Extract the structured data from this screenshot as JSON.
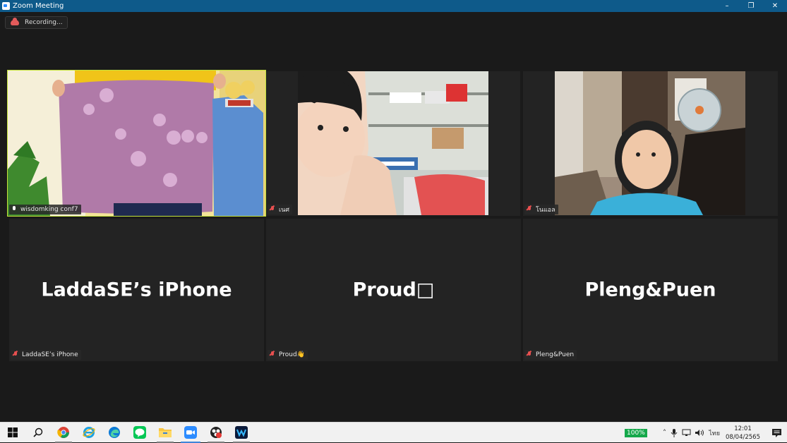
{
  "window": {
    "title": "Zoom Meeting",
    "controls": [
      "–",
      "❐",
      "✕"
    ]
  },
  "recording": {
    "label": "Recording..."
  },
  "participants": [
    {
      "name": "wisdomking conf7",
      "muted": false,
      "active": true,
      "video": true
    },
    {
      "name": "เนศ",
      "muted": true,
      "video": true
    },
    {
      "name": "โนแอล",
      "muted": true,
      "video": true
    },
    {
      "name": "LaddaSE’s iPhone",
      "muted": true,
      "video": false,
      "display_name": "LaddaSE’s iPhone"
    },
    {
      "name": "Proud👋",
      "muted": true,
      "video": false,
      "display_name": "Proud□"
    },
    {
      "name": "Pleng&Puen",
      "muted": true,
      "video": false,
      "display_name": "Pleng&Puen"
    }
  ],
  "taskbar": {
    "apps": [
      "start",
      "search",
      "chrome",
      "internet-explorer",
      "edge",
      "line",
      "file-explorer",
      "zoom",
      "obs",
      "meeting-app"
    ],
    "tray": {
      "battery": "100%",
      "language": "ไทย",
      "time": "12:01",
      "date": "08/04/2565"
    }
  }
}
